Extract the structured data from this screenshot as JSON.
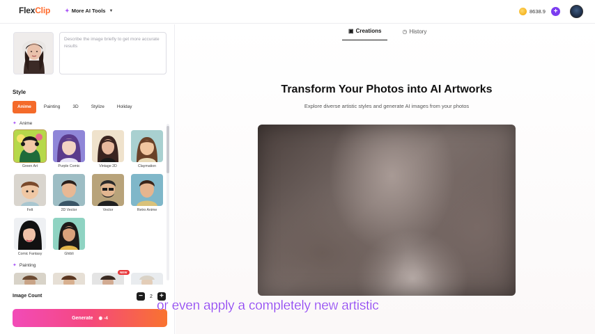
{
  "header": {
    "logo_text_a": "Flex",
    "logo_text_b": "Clip",
    "tools_label": "More AI Tools",
    "credits": "8638.9",
    "add_label": "+"
  },
  "left": {
    "prompt_placeholder": "Describe the image briefly to get more accurate results",
    "style_heading": "Style",
    "tabs": [
      "Anime",
      "Painting",
      "3D",
      "Stylize",
      "Holiday"
    ],
    "section_anime": "Anime",
    "section_painting": "Painting",
    "styles": [
      {
        "label": "Green Art"
      },
      {
        "label": "Purple Comic"
      },
      {
        "label": "Vintage 2D"
      },
      {
        "label": "Claymation"
      },
      {
        "label": "Felt"
      },
      {
        "label": "2D Vector"
      },
      {
        "label": "Vector"
      },
      {
        "label": "Retro Anime"
      },
      {
        "label": "Comic Fantasy"
      },
      {
        "label": "Ghibli"
      }
    ],
    "new_badge": "NEW",
    "image_count_label": "Image Count",
    "image_count_value": "2",
    "minus": "−",
    "plus": "+",
    "generate_label": "Generate",
    "generate_cost": "-4"
  },
  "right": {
    "tab_creations": "Creations",
    "tab_history": "History",
    "title": "Transform Your Photos into AI Artworks",
    "subtitle": "Explore diverse artistic styles and generate AI images from your photos"
  },
  "caption": "or even apply a completely new artistic",
  "colors": {
    "accent_orange": "#f46a2a",
    "accent_purple": "#7b3cf0",
    "caption_purple": "#8a3cf0"
  }
}
